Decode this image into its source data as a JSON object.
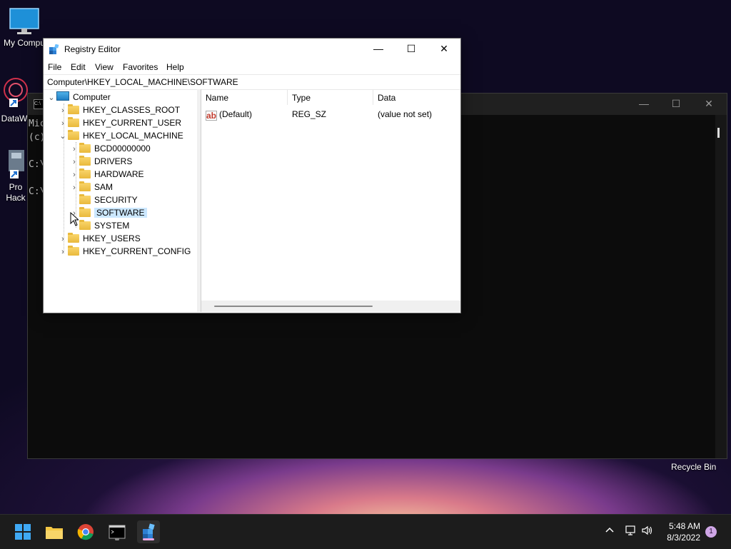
{
  "desktop": {
    "icons": [
      {
        "label": "My Compu"
      },
      {
        "label": "DataW"
      },
      {
        "label": "Pro Hack"
      }
    ],
    "recycle_bin": "Recycle Bin"
  },
  "terminal": {
    "lines": [
      "Mic",
      "(c)",
      "",
      "C:\\",
      "",
      "C:\\"
    ],
    "min": "—",
    "max": "☐",
    "close": "✕"
  },
  "regedit": {
    "title": "Registry Editor",
    "min": "—",
    "max": "☐",
    "close": "✕",
    "menu": [
      "File",
      "Edit",
      "View",
      "Favorites",
      "Help"
    ],
    "address": "Computer\\HKEY_LOCAL_MACHINE\\SOFTWARE",
    "tree": {
      "root": "Computer",
      "hkcr": "HKEY_CLASSES_ROOT",
      "hkcu": "HKEY_CURRENT_USER",
      "hklm": "HKEY_LOCAL_MACHINE",
      "bcd": "BCD00000000",
      "drivers": "DRIVERS",
      "hardware": "HARDWARE",
      "sam": "SAM",
      "security": "SECURITY",
      "software": "SOFTWARE",
      "system": "SYSTEM",
      "hku": "HKEY_USERS",
      "hkcc": "HKEY_CURRENT_CONFIG"
    },
    "columns": {
      "name": "Name",
      "type": "Type",
      "data": "Data"
    },
    "values": [
      {
        "name": "(Default)",
        "type": "REG_SZ",
        "data": "(value not set)"
      }
    ]
  },
  "taskbar": {
    "time": "5:48 AM",
    "date": "8/3/2022",
    "notification_count": "1",
    "accent": "#e8a6e0"
  }
}
